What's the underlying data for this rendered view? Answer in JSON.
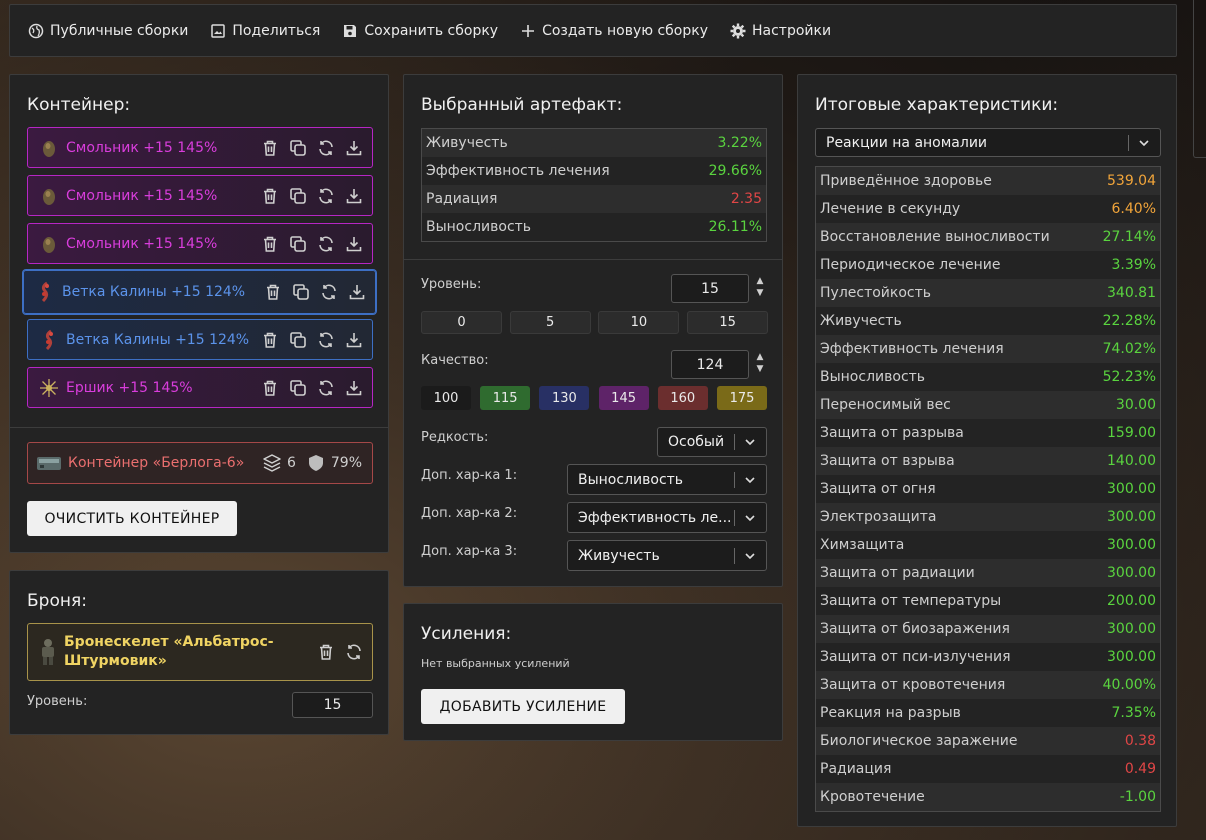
{
  "topbar": {
    "public": "Публичные сборки",
    "share": "Поделиться",
    "save": "Сохранить сборку",
    "create": "Создать новую сборку",
    "settings": "Настройки"
  },
  "container": {
    "title": "Контейнер:",
    "artifacts": [
      {
        "name": "Смольник +15 145%",
        "rarity": "purple"
      },
      {
        "name": "Смольник +15 145%",
        "rarity": "purple"
      },
      {
        "name": "Смольник +15 145%",
        "rarity": "purple"
      },
      {
        "name": "Ветка Калины +15 124%",
        "rarity": "blue",
        "selected": true
      },
      {
        "name": "Ветка Калины +15 124%",
        "rarity": "blue"
      },
      {
        "name": "Ершик +15 145%",
        "rarity": "purple"
      }
    ],
    "container_item": {
      "name": "Контейнер «Берлога-6»",
      "slots": "6",
      "protection": "79%"
    },
    "clear_button": "ОЧИСТИТЬ КОНТЕЙНЕР"
  },
  "armor": {
    "title": "Броня:",
    "name": "Бронескелет «Альбатрос-Штурмовик»",
    "level_label": "Уровень:",
    "level_value": "15"
  },
  "artifact": {
    "title": "Выбранный артефакт:",
    "stats": [
      {
        "label": "Живучесть",
        "value": "3.22%",
        "color": "green"
      },
      {
        "label": "Эффективность лечения",
        "value": "29.66%",
        "color": "green"
      },
      {
        "label": "Радиация",
        "value": "2.35",
        "color": "red"
      },
      {
        "label": "Выносливость",
        "value": "26.11%",
        "color": "green"
      }
    ],
    "level_label": "Уровень:",
    "level_value": "15",
    "level_presets": [
      "0",
      "5",
      "10",
      "15"
    ],
    "quality_label": "Качество:",
    "quality_value": "124",
    "quality_presets": [
      {
        "label": "100",
        "color": "#1b1b1b"
      },
      {
        "label": "115",
        "color": "#2f6b2f"
      },
      {
        "label": "130",
        "color": "#283064"
      },
      {
        "label": "145",
        "color": "#5e2368"
      },
      {
        "label": "160",
        "color": "#6b2e2e"
      },
      {
        "label": "175",
        "color": "#7a6a18"
      }
    ],
    "rarity_label": "Редкость:",
    "rarity_value": "Особый",
    "extra1_label": "Доп. хар-ка 1:",
    "extra1_value": "Выносливость",
    "extra2_label": "Доп. хар-ка 2:",
    "extra2_value": "Эффективность ле...",
    "extra3_label": "Доп. хар-ка 3:",
    "extra3_value": "Живучесть"
  },
  "boosts": {
    "title": "Усиления:",
    "empty": "Нет выбранных усилений",
    "add_button": "ДОБАВИТЬ УСИЛЕНИЕ"
  },
  "totals": {
    "title": "Итоговые характеристики:",
    "filter_value": "Реакции на аномалии",
    "stats": [
      {
        "label": "Приведённое здоровье",
        "value": "539.04",
        "color": "orange"
      },
      {
        "label": "Лечение в секунду",
        "value": "6.40%",
        "color": "orange"
      },
      {
        "label": "Восстановление выносливости",
        "value": "27.14%",
        "color": "green"
      },
      {
        "label": "Периодическое лечение",
        "value": "3.39%",
        "color": "green"
      },
      {
        "label": "Пулестойкость",
        "value": "340.81",
        "color": "green"
      },
      {
        "label": "Живучесть",
        "value": "22.28%",
        "color": "green"
      },
      {
        "label": "Эффективность лечения",
        "value": "74.02%",
        "color": "green"
      },
      {
        "label": "Выносливость",
        "value": "52.23%",
        "color": "green"
      },
      {
        "label": "Переносимый вес",
        "value": "30.00",
        "color": "green"
      },
      {
        "label": "Защита от разрыва",
        "value": "159.00",
        "color": "green"
      },
      {
        "label": "Защита от взрыва",
        "value": "140.00",
        "color": "green"
      },
      {
        "label": "Защита от огня",
        "value": "300.00",
        "color": "green"
      },
      {
        "label": "Электрозащита",
        "value": "300.00",
        "color": "green"
      },
      {
        "label": "Химзащита",
        "value": "300.00",
        "color": "green"
      },
      {
        "label": "Защита от радиации",
        "value": "300.00",
        "color": "green"
      },
      {
        "label": "Защита от температуры",
        "value": "200.00",
        "color": "green"
      },
      {
        "label": "Защита от биозаражения",
        "value": "300.00",
        "color": "green"
      },
      {
        "label": "Защита от пси-излучения",
        "value": "300.00",
        "color": "green"
      },
      {
        "label": "Защита от кровотечения",
        "value": "40.00%",
        "color": "green"
      },
      {
        "label": "Реакция на разрыв",
        "value": "7.35%",
        "color": "green"
      },
      {
        "label": "Биологическое заражение",
        "value": "0.38",
        "color": "red"
      },
      {
        "label": "Радиация",
        "value": "0.49",
        "color": "red"
      },
      {
        "label": "Кровотечение",
        "value": "-1.00",
        "color": "green"
      }
    ]
  }
}
